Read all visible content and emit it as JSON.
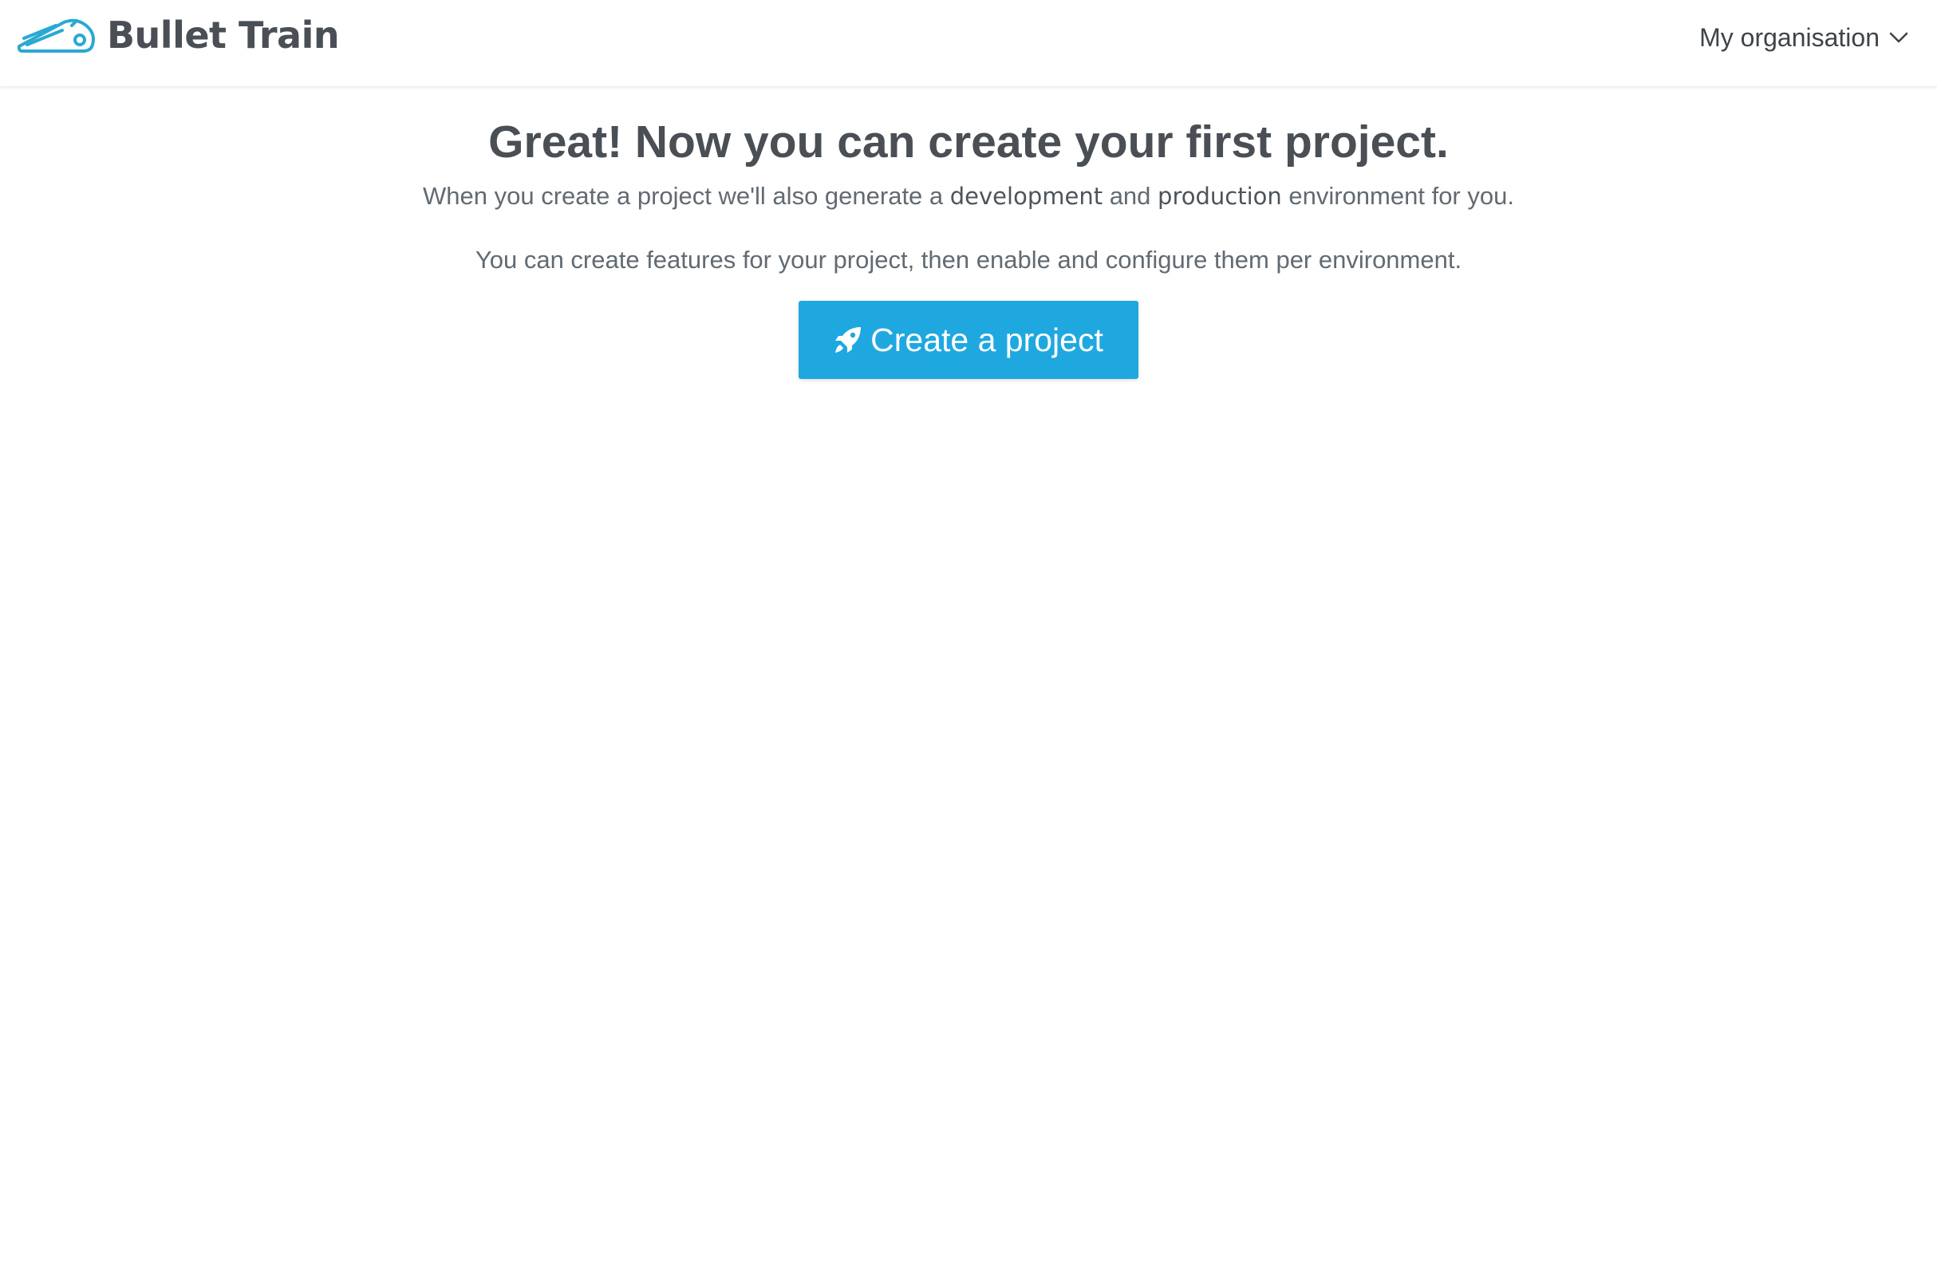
{
  "navbar": {
    "brand_name": "Bullet Train",
    "org_menu_label": "My organisation"
  },
  "main": {
    "headline": "Great! Now you can create your first project.",
    "intro_before": "When you create a project we'll also generate a ",
    "env_dev": "development",
    "intro_middle": " and ",
    "env_prod": "production",
    "intro_after": " environment for you.",
    "secondary_text": "You can create features for your project, then enable and configure them per environment.",
    "cta_label": "Create a project"
  },
  "icons": {
    "logo": "bullet-train-logo-icon",
    "org_menu": "chevron-down-icon",
    "cta": "rocket-icon"
  },
  "colors": {
    "brand_accent": "#1fa8e0",
    "text_dark": "#4a4f55"
  }
}
